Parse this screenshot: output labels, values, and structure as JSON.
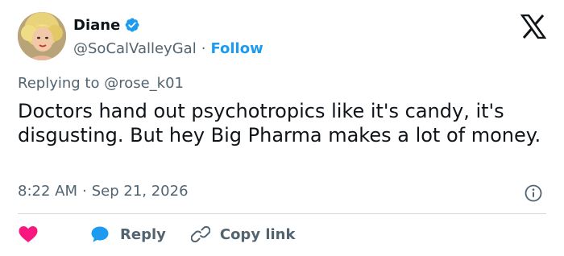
{
  "author": {
    "name": "Diane",
    "handle": "@SoCalValleyGal",
    "separator": "·",
    "follow_label": "Follow"
  },
  "reply_context": {
    "prefix": "Replying to ",
    "mention": "@rose_k01"
  },
  "tweet": {
    "text": "Doctors hand out psychotropics like it's candy, it's disgusting. But hey Big Pharma makes a lot of money.",
    "time": "8:22 AM",
    "date_separator": "·",
    "date": "Sep 21, 2026"
  },
  "actions": {
    "reply_label": "Reply",
    "copy_link_label": "Copy link"
  },
  "icons": {
    "verified": "verified-badge-icon",
    "brand": "x-logo-icon",
    "info": "info-icon",
    "like": "heart-icon",
    "reply": "speech-bubble-icon",
    "copy": "link-icon"
  },
  "colors": {
    "accent": "#1d9bf0",
    "heart": "#f91880",
    "text": "#0f1419",
    "secondary": "#536471",
    "divider": "#cfd9de"
  }
}
